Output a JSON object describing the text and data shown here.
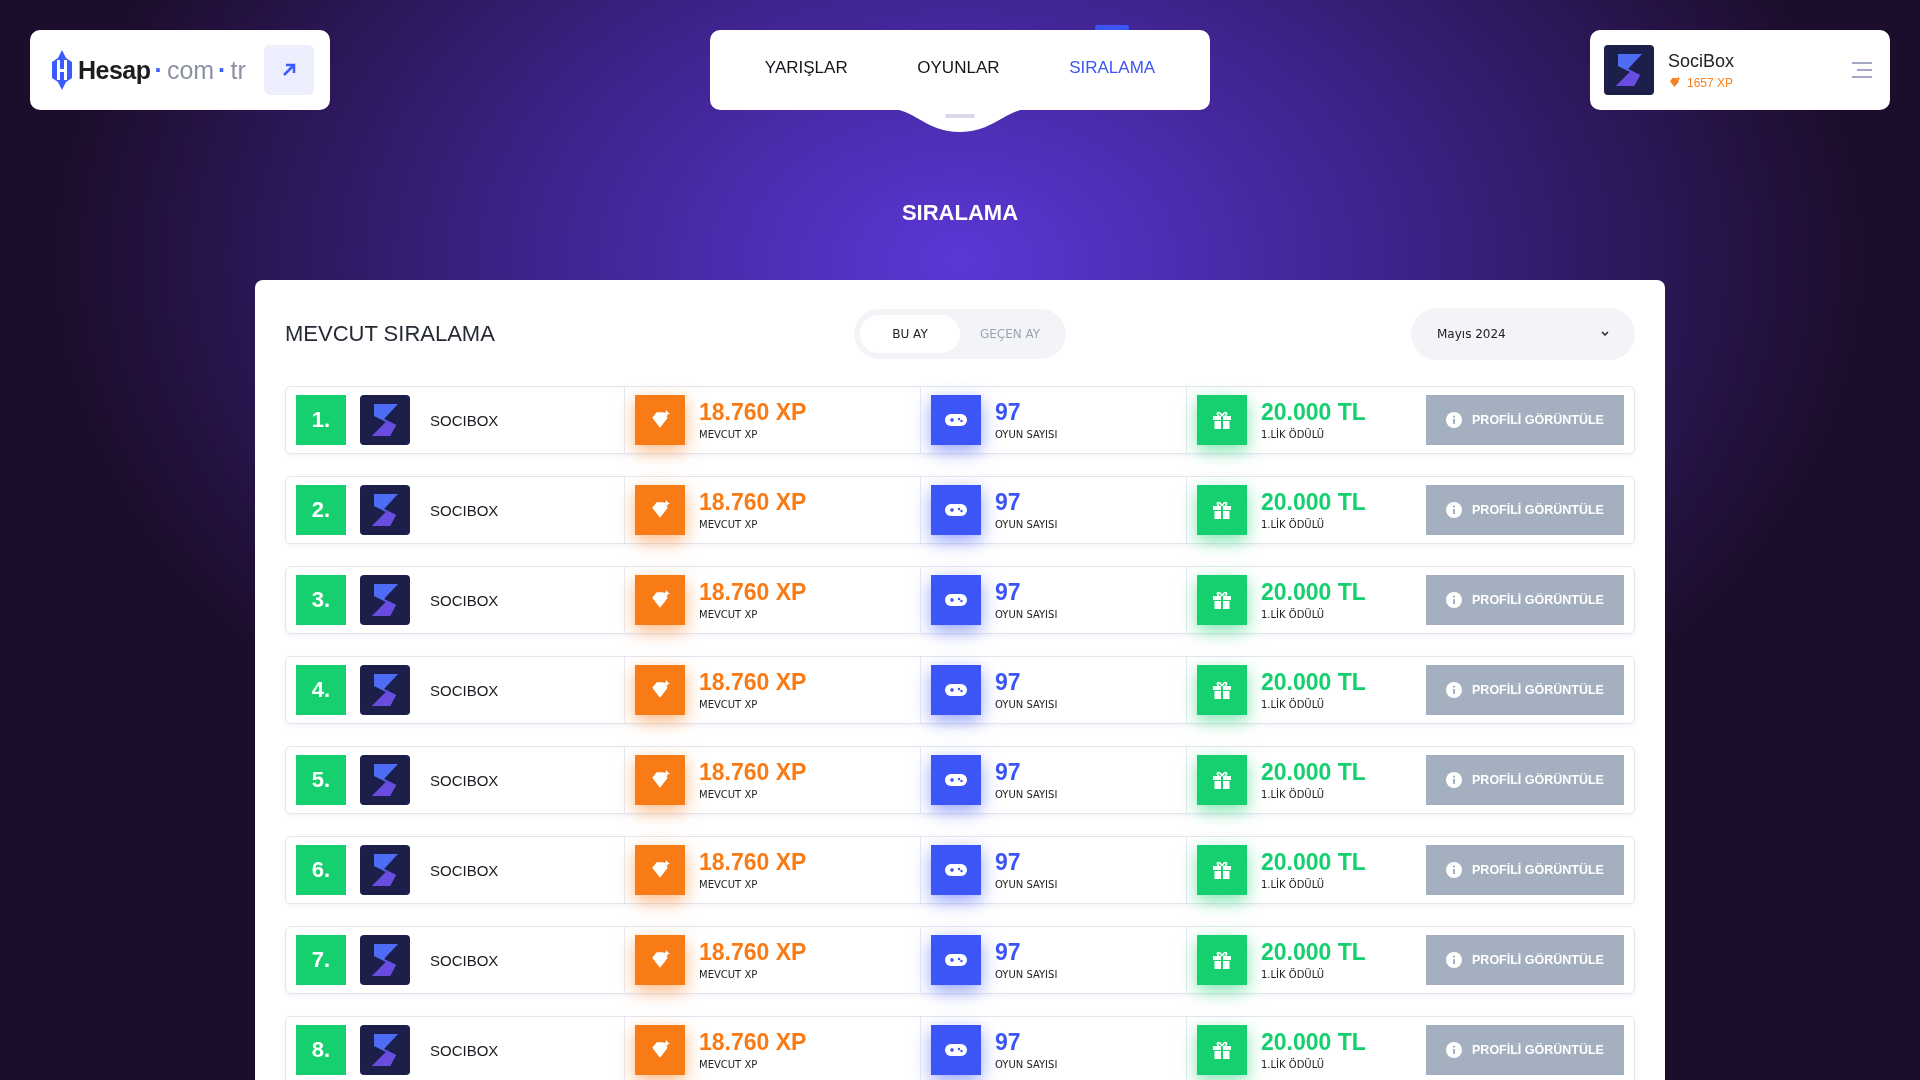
{
  "logo": {
    "brand": "Hesap",
    "dot1": "·",
    "com": "com",
    "dot2": "·",
    "tld": "tr"
  },
  "tabs": [
    {
      "label": "YARIŞLAR",
      "selected": false
    },
    {
      "label": "OYUNLAR",
      "selected": false
    },
    {
      "label": "SIRALAMA",
      "selected": true
    }
  ],
  "user": {
    "name": "SociBox",
    "xp": "1657 XP"
  },
  "page_title": "SIRALAMA",
  "panel": {
    "title": "MEVCUT SIRALAMA",
    "periods": [
      {
        "label": "BU AY",
        "selected": true
      },
      {
        "label": "GEÇEN AY",
        "selected": false
      }
    ],
    "month": "Mayıs 2024",
    "rows": [
      {
        "rank": "1.",
        "name": "SOCIBOX",
        "xp": "18.760 XP",
        "xp_label": "MEVCUT XP",
        "games": "97",
        "games_label": "OYUN SAYISI",
        "prize": "20.000 TL",
        "prize_label": "1.LİK ÖDÜLÜ",
        "button": "PROFİLİ GÖRÜNTÜLE"
      },
      {
        "rank": "2.",
        "name": "SOCIBOX",
        "xp": "18.760 XP",
        "xp_label": "MEVCUT XP",
        "games": "97",
        "games_label": "OYUN SAYISI",
        "prize": "20.000 TL",
        "prize_label": "1.LİK ÖDÜLÜ",
        "button": "PROFİLİ GÖRÜNTÜLE"
      },
      {
        "rank": "3.",
        "name": "SOCIBOX",
        "xp": "18.760 XP",
        "xp_label": "MEVCUT XP",
        "games": "97",
        "games_label": "OYUN SAYISI",
        "prize": "20.000 TL",
        "prize_label": "1.LİK ÖDÜLÜ",
        "button": "PROFİLİ GÖRÜNTÜLE"
      },
      {
        "rank": "4.",
        "name": "SOCIBOX",
        "xp": "18.760 XP",
        "xp_label": "MEVCUT XP",
        "games": "97",
        "games_label": "OYUN SAYISI",
        "prize": "20.000 TL",
        "prize_label": "1.LİK ÖDÜLÜ",
        "button": "PROFİLİ GÖRÜNTÜLE"
      },
      {
        "rank": "5.",
        "name": "SOCIBOX",
        "xp": "18.760 XP",
        "xp_label": "MEVCUT XP",
        "games": "97",
        "games_label": "OYUN SAYISI",
        "prize": "20.000 TL",
        "prize_label": "1.LİK ÖDÜLÜ",
        "button": "PROFİLİ GÖRÜNTÜLE"
      },
      {
        "rank": "6.",
        "name": "SOCIBOX",
        "xp": "18.760 XP",
        "xp_label": "MEVCUT XP",
        "games": "97",
        "games_label": "OYUN SAYISI",
        "prize": "20.000 TL",
        "prize_label": "1.LİK ÖDÜLÜ",
        "button": "PROFİLİ GÖRÜNTÜLE"
      },
      {
        "rank": "7.",
        "name": "SOCIBOX",
        "xp": "18.760 XP",
        "xp_label": "MEVCUT XP",
        "games": "97",
        "games_label": "OYUN SAYISI",
        "prize": "20.000 TL",
        "prize_label": "1.LİK ÖDÜLÜ",
        "button": "PROFİLİ GÖRÜNTÜLE"
      },
      {
        "rank": "8.",
        "name": "SOCIBOX",
        "xp": "18.760 XP",
        "xp_label": "MEVCUT XP",
        "games": "97",
        "games_label": "OYUN SAYISI",
        "prize": "20.000 TL",
        "prize_label": "1.LİK ÖDÜLÜ",
        "button": "PROFİLİ GÖRÜNTÜLE"
      }
    ]
  }
}
